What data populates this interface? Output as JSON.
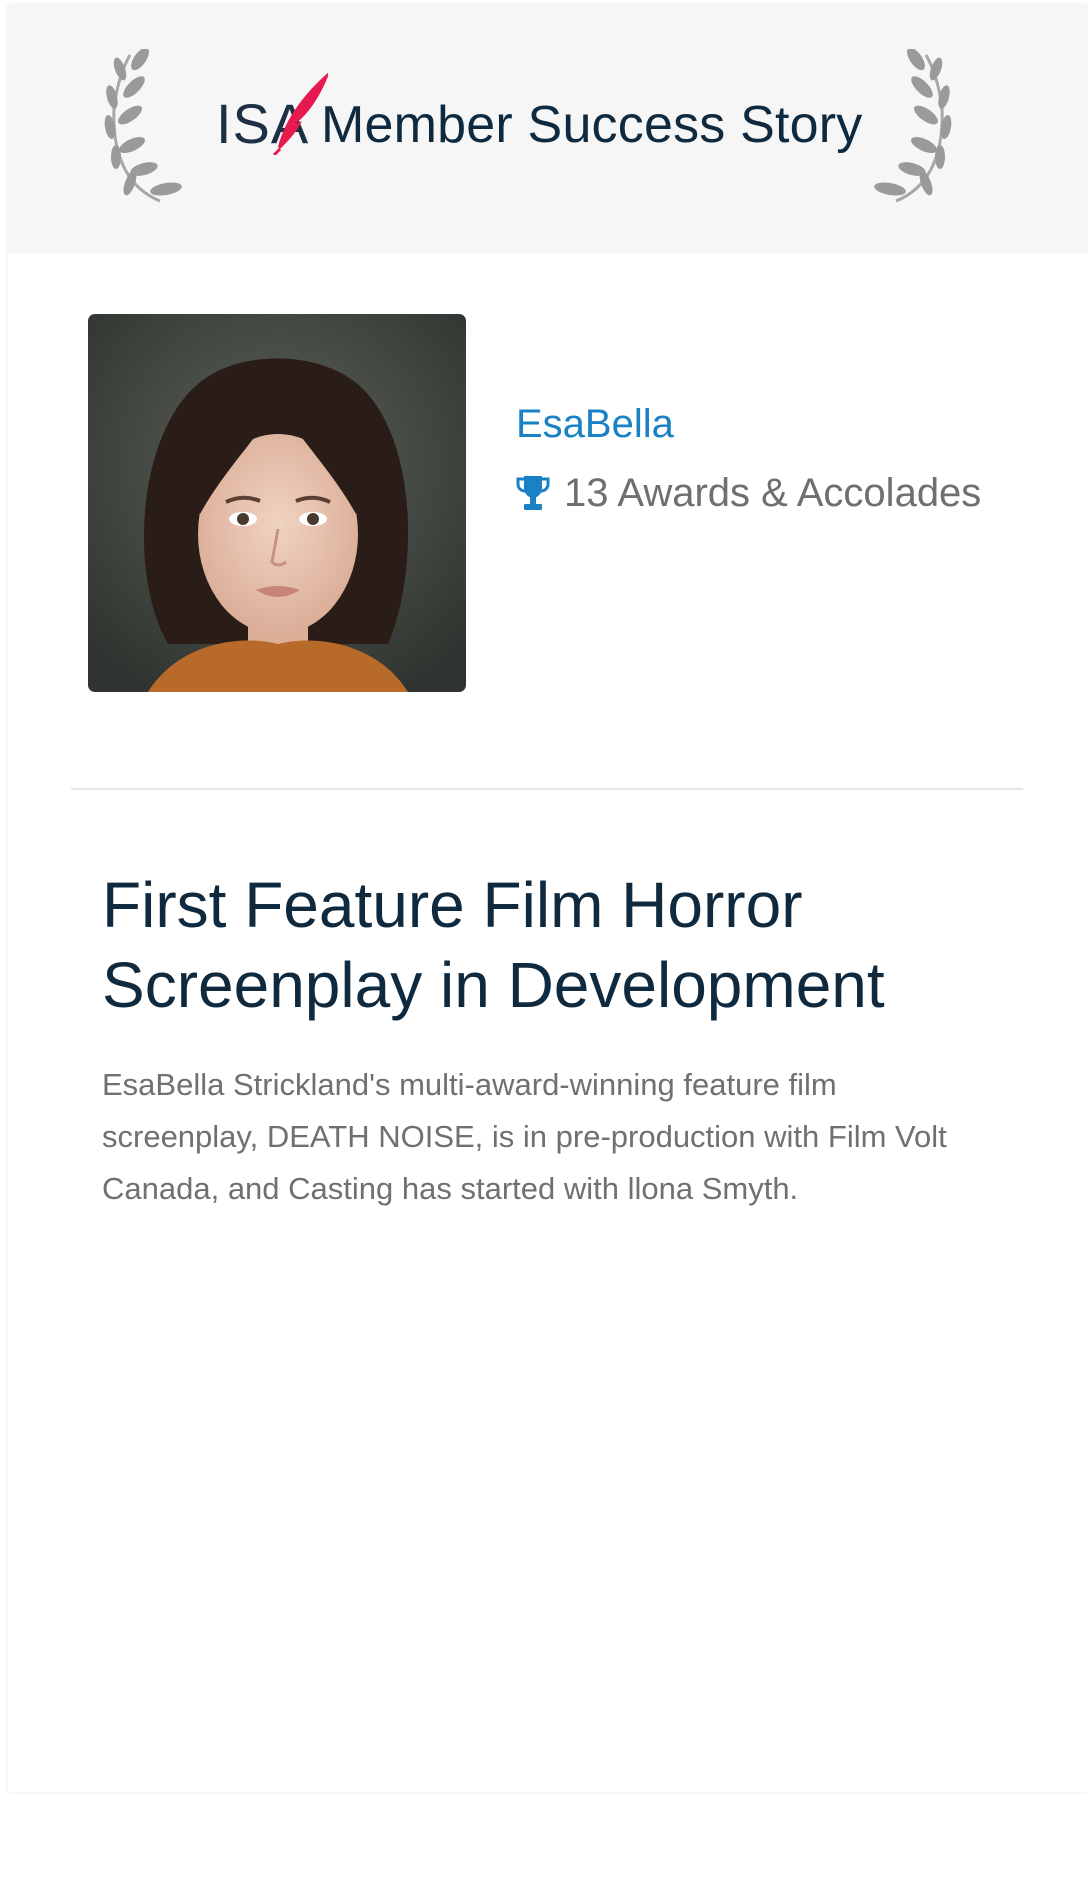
{
  "header": {
    "logo_text": "ISA",
    "title": "Member Success Story"
  },
  "member": {
    "name": "EsaBella",
    "awards": "13 Awards & Accolades",
    "awards_icon": "trophy-icon"
  },
  "story": {
    "title": "First Feature Film Horror Screenplay in Development",
    "body": "EsaBella Strickland's multi-award-winning feature film screenplay, DEATH NOISE, is in pre-production with Film Volt Canada, and Casting has started with llona Smyth."
  },
  "colors": {
    "header_bg": "#f6f6f6",
    "title_navy": "#0f2a3f",
    "link_blue": "#1a82c4",
    "logo_red": "#e8194e",
    "muted_gray": "#707070"
  }
}
